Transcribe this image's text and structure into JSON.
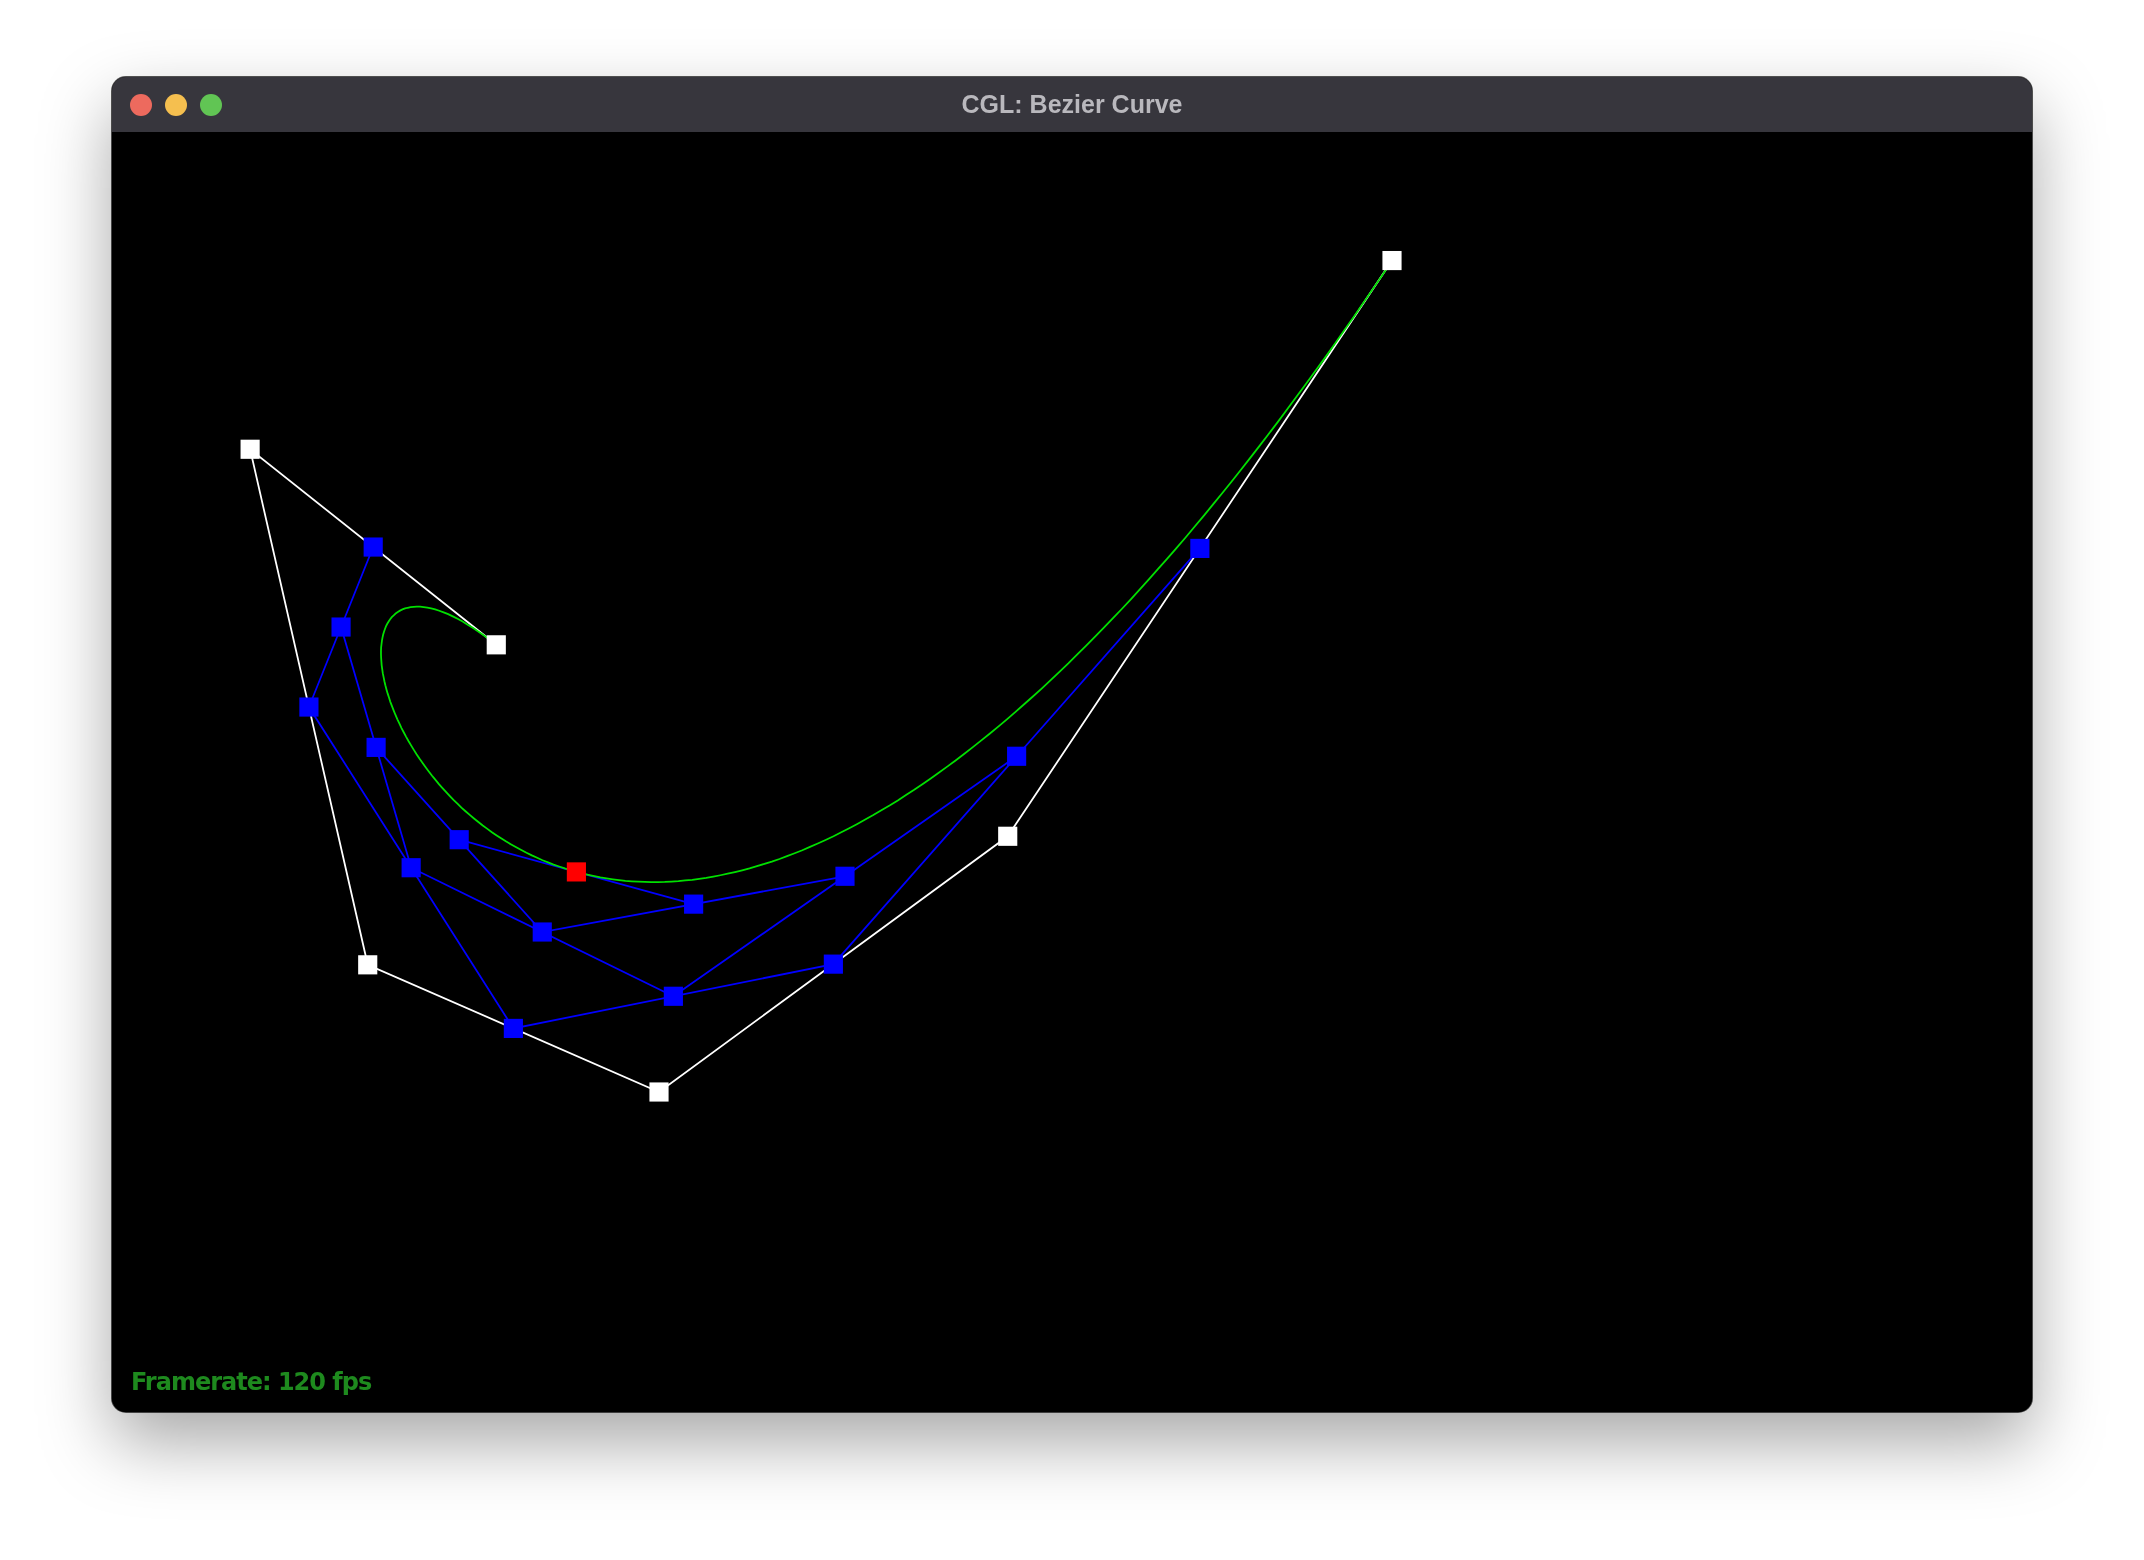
{
  "window": {
    "title": "CGL: Bezier Curve"
  },
  "canvas": {
    "status": "Framerate: 120 fps"
  }
}
